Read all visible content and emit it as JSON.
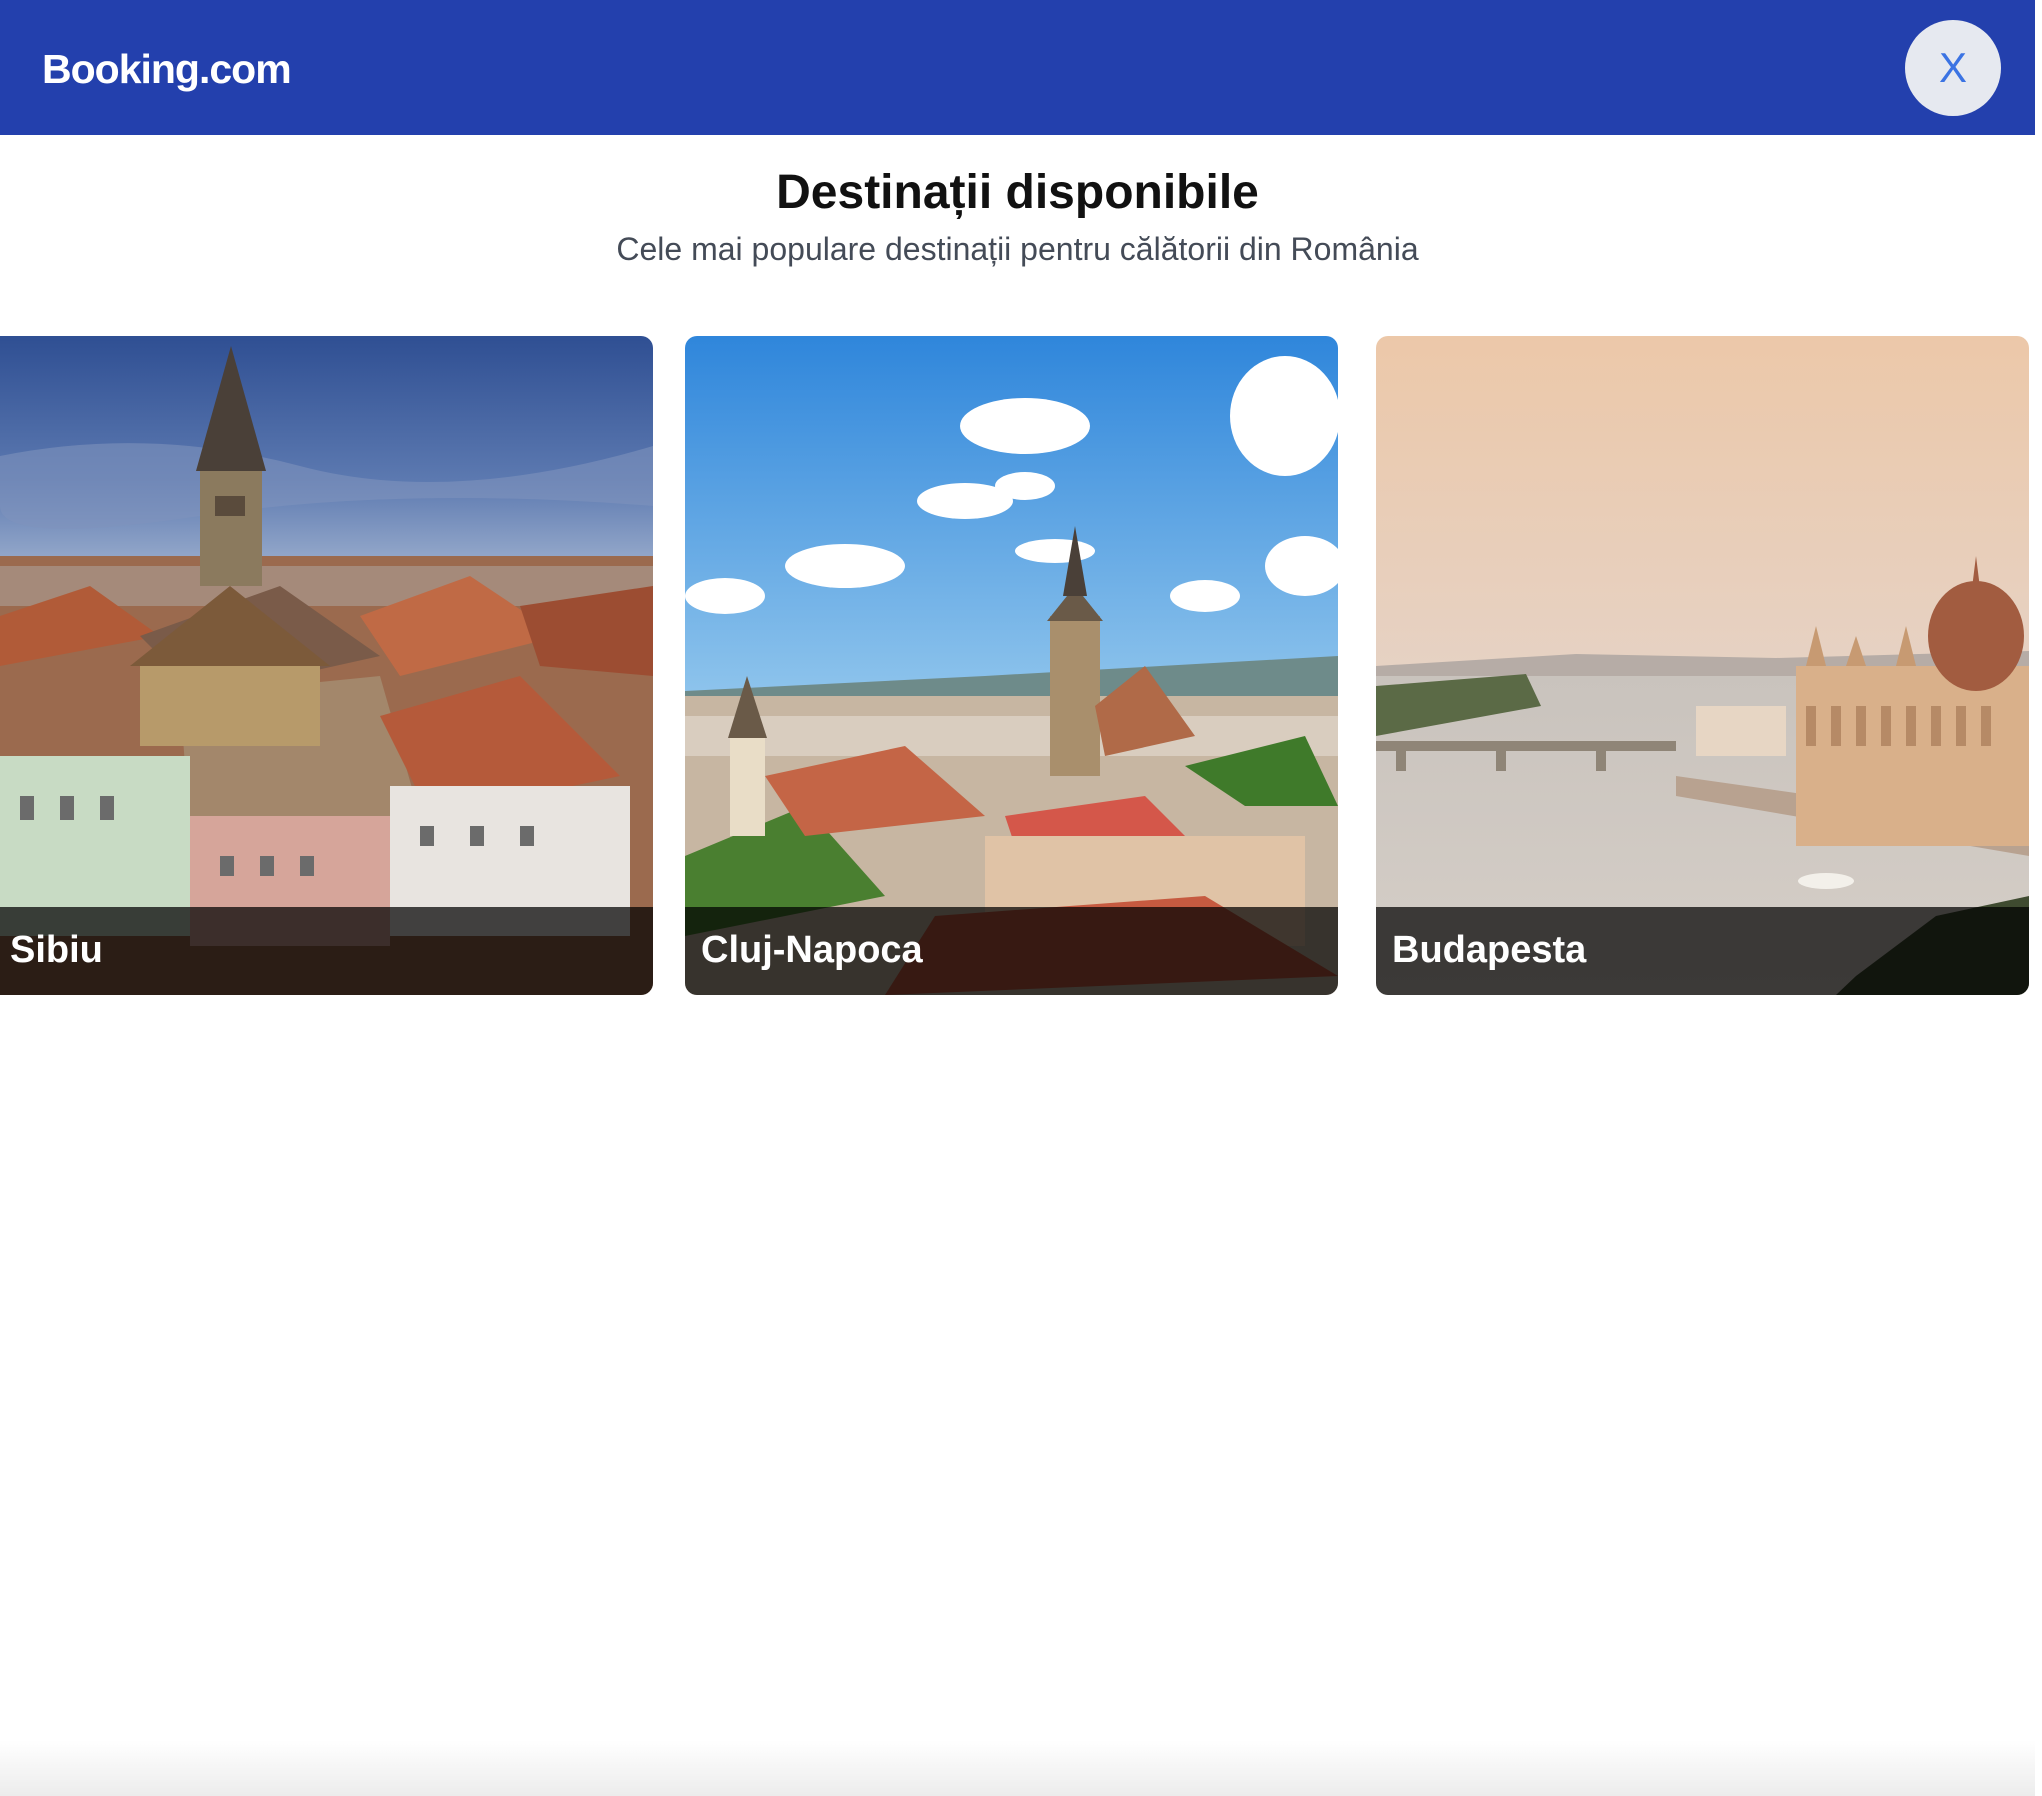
{
  "header": {
    "logo": "Booking.com",
    "close_label": "X",
    "background": "#2340ad"
  },
  "page": {
    "title": "Destinații disponibile",
    "subtitle": "Cele mai populare destinații pentru călătorii din România"
  },
  "destinations": [
    {
      "name": "Sibiu",
      "image": "Sibiu old town rooftops with church spire"
    },
    {
      "name": "Cluj-Napoca",
      "image": "Cluj-Napoca skyline with cathedral under blue sky"
    },
    {
      "name": "Budapesta",
      "image": "Budapest parliament and Danube at sunset"
    }
  ]
}
